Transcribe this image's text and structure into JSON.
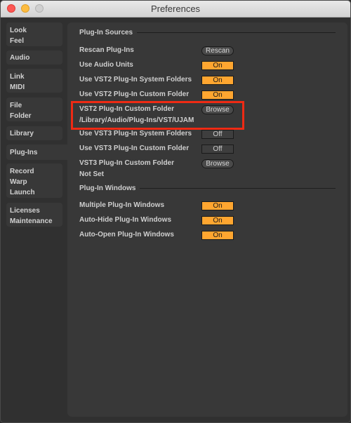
{
  "window": {
    "title": "Preferences",
    "controls": [
      "close",
      "minimize",
      "maximize"
    ]
  },
  "sidebar": {
    "tabs": [
      {
        "lines": [
          "Look",
          "Feel"
        ],
        "selected": false
      },
      {
        "lines": [
          "Audio"
        ],
        "selected": false
      },
      {
        "lines": [
          "Link",
          "MIDI"
        ],
        "selected": false
      },
      {
        "lines": [
          "File",
          "Folder"
        ],
        "selected": false
      },
      {
        "lines": [
          "Library"
        ],
        "selected": false
      },
      {
        "lines": [
          "Plug-Ins"
        ],
        "selected": true
      },
      {
        "lines": [
          "Record",
          "Warp",
          "Launch"
        ],
        "selected": false
      },
      {
        "lines": [
          "Licenses",
          "Maintenance"
        ],
        "selected": false
      }
    ]
  },
  "plugin_sources": {
    "header": "Plug-In Sources",
    "rescan": {
      "label": "Rescan Plug-Ins",
      "button": "Rescan"
    },
    "audio_units": {
      "label": "Use Audio Units",
      "value": "On"
    },
    "vst2_system": {
      "label": "Use VST2 Plug-In System Folders",
      "value": "On"
    },
    "vst2_custom": {
      "label": "Use VST2 Plug-In Custom Folder",
      "value": "On"
    },
    "vst2_folder": {
      "label": "VST2 Plug-In Custom Folder",
      "button": "Browse",
      "path": "/Library/Audio/Plug-Ins/VST/UJAM"
    },
    "vst3_system": {
      "label": "Use VST3 Plug-In System Folders",
      "value": "Off"
    },
    "vst3_custom": {
      "label": "Use VST3 Plug-In Custom Folder",
      "value": "Off"
    },
    "vst3_folder": {
      "label": "VST3 Plug-In Custom Folder",
      "button": "Browse",
      "path": "Not Set"
    }
  },
  "plugin_windows": {
    "header": "Plug-In Windows",
    "multiple": {
      "label": "Multiple Plug-In Windows",
      "value": "On"
    },
    "auto_hide": {
      "label": "Auto-Hide Plug-In Windows",
      "value": "On"
    },
    "auto_open": {
      "label": "Auto-Open Plug-In Windows",
      "value": "On"
    }
  },
  "colors": {
    "toggle_on": "#ffa630",
    "highlight": "#ee2a14"
  }
}
